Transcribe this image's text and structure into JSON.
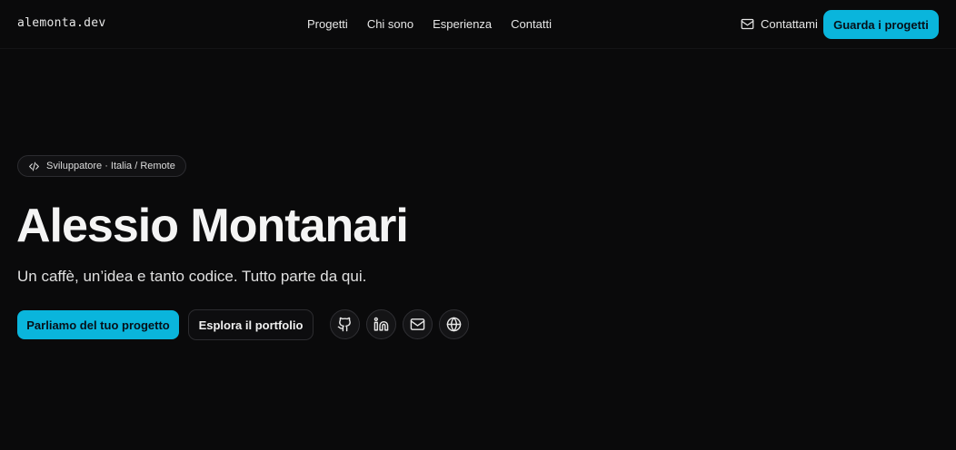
{
  "header": {
    "logo": "alemonta.dev",
    "nav": [
      "Progetti",
      "Chi sono",
      "Esperienza",
      "Contatti"
    ],
    "contact_label": "Contattami",
    "cta_label": "Guarda i progetti"
  },
  "hero": {
    "badge": "Sviluppatore · Italia / Remote",
    "title": "Alessio Montanari",
    "subtitle": "Un caffè, un’idea e tanto codice. Tutto parte da qui.",
    "primary_cta": "Parliamo del tuo progetto",
    "secondary_cta": "Esplora il portfolio",
    "socials": [
      "github-icon",
      "linkedin-icon",
      "mail-icon",
      "globe-icon"
    ]
  },
  "colors": {
    "background": "#0a0a0b",
    "accent": "#0ab5dc",
    "text": "#f2f2f2"
  }
}
